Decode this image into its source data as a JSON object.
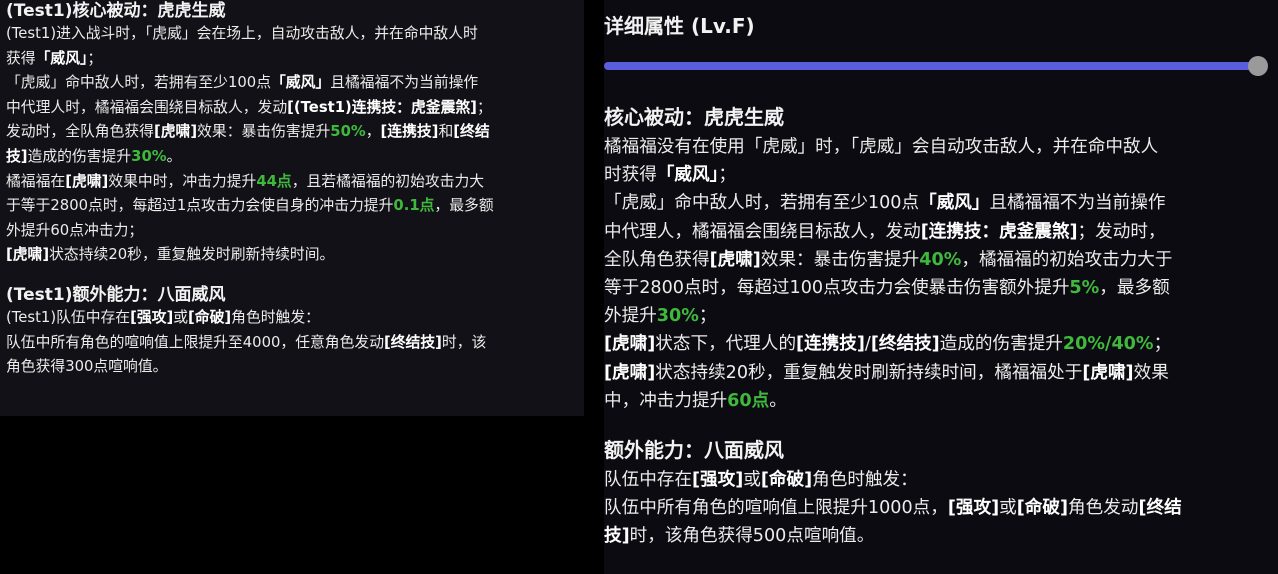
{
  "colors": {
    "background": "#000000",
    "left_panel_bg": "#111117",
    "right_panel_bg": "#0b0b11",
    "text": "#ececec",
    "highlight_white": "#ffffff",
    "highlight_green": "#3fb93c",
    "slider_track": "#5a5ddc",
    "slider_thumb": "#9a9a9a"
  },
  "left_panel": {
    "core_title": "(Test1)核心被动：虎虎生威",
    "core_lines": [
      [
        {
          "t": "(Test1)进入战斗时，「虎威」会在场上，自动攻击敌人，并在命中敌人时"
        }
      ],
      [
        {
          "t": "获得"
        },
        {
          "t": "「威风」",
          "s": "b"
        },
        {
          "t": "；"
        }
      ],
      [
        {
          "t": "「虎威」命中敌人时，若拥有至少100点"
        },
        {
          "t": "「威风」",
          "s": "b"
        },
        {
          "t": "且橘福福不为当前操作"
        }
      ],
      [
        {
          "t": "中代理人时，橘福福会围绕目标敌人，发动"
        },
        {
          "t": "[(Test1)连携技：虎釜震煞]",
          "s": "b"
        },
        {
          "t": "；"
        }
      ],
      [
        {
          "t": "发动时，全队角色获得"
        },
        {
          "t": "[虎啸]",
          "s": "b"
        },
        {
          "t": "效果：暴击伤害提升"
        },
        {
          "t": "50%",
          "s": "g"
        },
        {
          "t": "，"
        },
        {
          "t": "[连携技]",
          "s": "b"
        },
        {
          "t": "和"
        },
        {
          "t": "[终结",
          "s": "b"
        }
      ],
      [
        {
          "t": "技]",
          "s": "b"
        },
        {
          "t": "造成的伤害提升"
        },
        {
          "t": "30%",
          "s": "g"
        },
        {
          "t": "。"
        }
      ],
      [
        {
          "t": "橘福福在"
        },
        {
          "t": "[虎啸]",
          "s": "b"
        },
        {
          "t": "效果中时，冲击力提升"
        },
        {
          "t": "44点",
          "s": "g"
        },
        {
          "t": "，且若橘福福的初始攻击力大"
        }
      ],
      [
        {
          "t": "于等于2800点时，每超过1点攻击力会使自身的冲击力提升"
        },
        {
          "t": "0.1点",
          "s": "g"
        },
        {
          "t": "，最多额"
        }
      ],
      [
        {
          "t": "外提升60点冲击力；"
        }
      ],
      [
        {
          "t": "[虎啸]",
          "s": "b"
        },
        {
          "t": "状态持续20秒，重复触发时刷新持续时间。"
        }
      ]
    ],
    "extra_title": "(Test1)额外能力：八面威风",
    "extra_lines": [
      [
        {
          "t": "(Test1)队伍中存在"
        },
        {
          "t": "[强攻]",
          "s": "b"
        },
        {
          "t": "或"
        },
        {
          "t": "[命破]",
          "s": "b"
        },
        {
          "t": "角色时触发："
        }
      ],
      [
        {
          "t": "队伍中所有角色的喧响值上限提升至4000，任意角色发动"
        },
        {
          "t": "[终结技]",
          "s": "b"
        },
        {
          "t": "时，该"
        }
      ],
      [
        {
          "t": "角色获得300点喧响值。"
        }
      ]
    ]
  },
  "right_panel": {
    "header": "详细属性 (Lv.F)",
    "level_slider": {
      "value": 1.0
    },
    "core_title": "核心被动：虎虎生威",
    "core_lines": [
      [
        {
          "t": "橘福福没有在使用「虎威」时，「虎威」会自动攻击敌人，并在命中敌人"
        }
      ],
      [
        {
          "t": "时获得"
        },
        {
          "t": "「威风」",
          "s": "b"
        },
        {
          "t": "；"
        }
      ],
      [
        {
          "t": "「虎威」命中敌人时，若拥有至少100点"
        },
        {
          "t": "「威风」",
          "s": "b"
        },
        {
          "t": "且橘福福不为当前操作"
        }
      ],
      [
        {
          "t": "中代理人，橘福福会围绕目标敌人，发动"
        },
        {
          "t": "[连携技：虎釜震煞]",
          "s": "b"
        },
        {
          "t": "；发动时，"
        }
      ],
      [
        {
          "t": "全队角色获得"
        },
        {
          "t": "[虎啸]",
          "s": "b"
        },
        {
          "t": "效果：暴击伤害提升"
        },
        {
          "t": "40%",
          "s": "g"
        },
        {
          "t": "，橘福福的初始攻击力大于"
        }
      ],
      [
        {
          "t": "等于2800点时，每超过100点攻击力会使暴击伤害额外提升"
        },
        {
          "t": "5%",
          "s": "g"
        },
        {
          "t": "，最多额"
        }
      ],
      [
        {
          "t": "外提升"
        },
        {
          "t": "30%",
          "s": "g"
        },
        {
          "t": "；"
        }
      ],
      [
        {
          "t": "[虎啸]",
          "s": "b"
        },
        {
          "t": "状态下，代理人的"
        },
        {
          "t": "[连携技]",
          "s": "b"
        },
        {
          "t": "/"
        },
        {
          "t": "[终结技]",
          "s": "b"
        },
        {
          "t": "造成的伤害提升"
        },
        {
          "t": "20%/40%",
          "s": "g"
        },
        {
          "t": "；"
        }
      ],
      [
        {
          "t": "[虎啸]",
          "s": "b"
        },
        {
          "t": "状态持续20秒，重复触发时刷新持续时间，橘福福处于"
        },
        {
          "t": "[虎啸]",
          "s": "b"
        },
        {
          "t": "效果"
        }
      ],
      [
        {
          "t": "中，冲击力提升"
        },
        {
          "t": "60点",
          "s": "g"
        },
        {
          "t": "。"
        }
      ]
    ],
    "extra_title": "额外能力：八面威风",
    "extra_lines": [
      [
        {
          "t": "队伍中存在"
        },
        {
          "t": "[强攻]",
          "s": "b"
        },
        {
          "t": "或"
        },
        {
          "t": "[命破]",
          "s": "b"
        },
        {
          "t": "角色时触发："
        }
      ],
      [
        {
          "t": "队伍中所有角色的喧响值上限提升1000点，"
        },
        {
          "t": "[强攻]",
          "s": "b"
        },
        {
          "t": "或"
        },
        {
          "t": "[命破]",
          "s": "b"
        },
        {
          "t": "角色发动"
        },
        {
          "t": "[终结",
          "s": "b"
        }
      ],
      [
        {
          "t": "技]",
          "s": "b"
        },
        {
          "t": "时，该角色获得500点喧响值。"
        }
      ]
    ]
  }
}
